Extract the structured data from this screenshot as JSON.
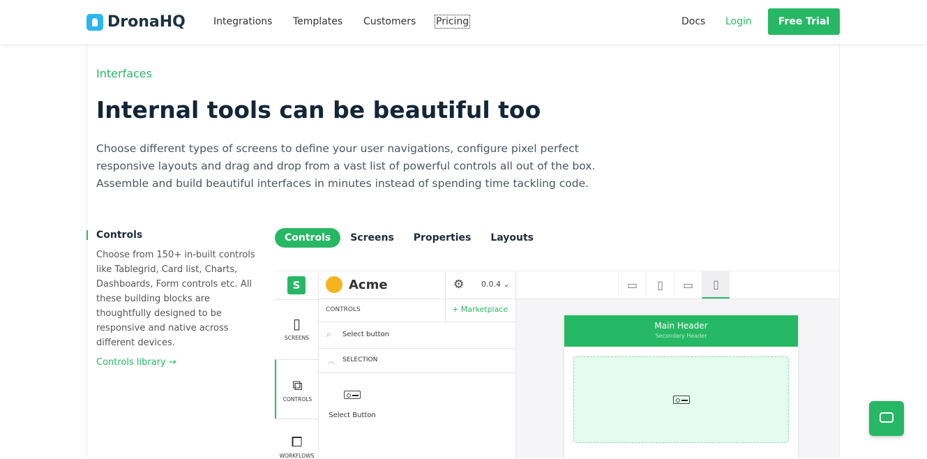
{
  "nav": {
    "brand": "DronaHQ",
    "links": [
      "Integrations",
      "Templates",
      "Customers",
      "Pricing"
    ],
    "docs": "Docs",
    "login": "Login",
    "trial": "Free Trial"
  },
  "hero": {
    "eyebrow": "Interfaces",
    "title": "Internal tools can be beautiful too",
    "lead": "Choose different types of screens to define your user navigations, configure pixel perfect responsive layouts and drag and drop from a vast list of powerful controls all out of the box. Assemble and build beautiful interfaces in minutes instead of spending time tackling code."
  },
  "side": {
    "title": "Controls",
    "desc": "Choose from 150+ in-built controls like Tablegrid, Card list, Charts, Dashboards, Form controls etc. All these building blocks are thoughtfully designed to be responsive and native across different devices.",
    "link": "Controls library →"
  },
  "tabs": [
    "Controls",
    "Screens",
    "Properties",
    "Layouts"
  ],
  "app": {
    "rail_logo": "S",
    "name": "Acme",
    "version": "0.0.4",
    "rail": [
      "SCREENS",
      "CONTROLS",
      "WORKFLOWS"
    ],
    "panel_title": "CONTROLS",
    "marketplace": "+ Marketplace",
    "search": "Select button",
    "section": "SELECTION",
    "control": "Select Button",
    "main_header": "Main Header",
    "secondary_header": "Secondary Header"
  }
}
